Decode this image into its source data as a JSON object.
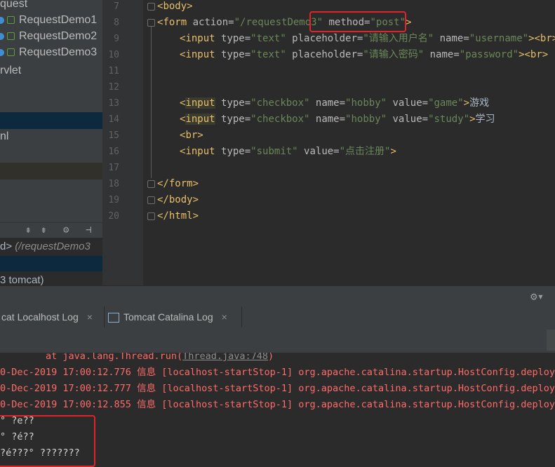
{
  "project_tree": {
    "items": [
      {
        "label": "quest"
      },
      {
        "label": "RequestDemo1"
      },
      {
        "label": "RequestDemo2"
      },
      {
        "label": "RequestDemo3"
      },
      {
        "label": "rvlet"
      },
      {
        "label": "nl"
      }
    ]
  },
  "editor": {
    "line_numbers": [
      "7",
      "8",
      "9",
      "10",
      "11",
      "12",
      "13",
      "14",
      "15",
      "16",
      "17",
      "18",
      "19",
      "20"
    ],
    "lines": {
      "l7": {
        "open": "<",
        "tag": "body",
        "close": ">"
      },
      "l8": {
        "open": "<",
        "tag": "form",
        "a1": " action=",
        "v1": "\"/requestDemo3\"",
        "a2": " method=",
        "v2": "\"post\"",
        "close": ">"
      },
      "l9": {
        "open": "<",
        "tag": "input",
        "a1": " type=",
        "v1": "\"text\"",
        "a2": " placeholder=",
        "v2": "\"请输入用户名\"",
        "a3": " name=",
        "v3": "\"username\"",
        "close": "><",
        "tag2": "br",
        "close2": ">"
      },
      "l10": {
        "open": "<",
        "tag": "input",
        "a1": " type=",
        "v1": "\"text\"",
        "a2": " placeholder=",
        "v2": "\"请输入密码\"",
        "a3": " name=",
        "v3": "\"password\"",
        "close": "><",
        "tag2": "br",
        "close2": ">"
      },
      "l13": {
        "open": "<",
        "tag": "input",
        "a1": " type=",
        "v1": "\"checkbox\"",
        "a2": " name=",
        "v2": "\"hobby\"",
        "a3": " value=",
        "v3": "\"game\"",
        "close": ">",
        "text": "游戏"
      },
      "l14": {
        "open": "<",
        "tag": "input",
        "a1": " type=",
        "v1": "\"checkbox\"",
        "a2": " name=",
        "v2": "\"hobby\"",
        "a3": " value=",
        "v3": "\"study\"",
        "close": ">",
        "text": "学习"
      },
      "l15": {
        "open": "<",
        "tag": "br",
        "close": ">"
      },
      "l16": {
        "open": "<",
        "tag": "input",
        "a1": " type=",
        "v1": "\"submit\"",
        "a2": " value=",
        "v2": "\"点击注册\"",
        "close": ">"
      },
      "l18": {
        "open": "</",
        "tag": "form",
        "close": ">"
      },
      "l19": {
        "open": "</",
        "tag": "body",
        "close": ">"
      },
      "l20": {
        "open": "</",
        "tag": "html",
        "close": ">"
      }
    }
  },
  "debug_panel": {
    "line1_prefix": "d>",
    "line1_path": "(/requestDemo3",
    "line2": "3  tomcat)"
  },
  "run_panel": {
    "tabs": [
      {
        "label": "cat Localhost Log"
      },
      {
        "label": "Tomcat Catalina Log"
      }
    ],
    "close_glyph": "×"
  },
  "console": {
    "stack_prefix": "        at java.lang.Thread.run(",
    "stack_link": "Thread.java:748",
    "stack_suffix": ")",
    "log_lines": [
      "0-Dec-2019 17:00:12.776 信息 [localhost-startStop-1] org.apache.catalina.startup.HostConfig.deployDe",
      "0-Dec-2019 17:00:12.777 信息 [localhost-startStop-1] org.apache.catalina.startup.HostConfig.deployDi",
      "0-Dec-2019 17:00:12.855 信息 [localhost-startStop-1] org.apache.catalina.startup.HostConfig.deployDi"
    ],
    "garbled_lines": [
      "° ?e??",
      "° ?é??",
      "?é???° ???????"
    ]
  },
  "colors": {
    "highlight_box": "#e0242a",
    "tag": "#e8bf6a",
    "string": "#6a8759",
    "log_red": "#ff6b68"
  }
}
